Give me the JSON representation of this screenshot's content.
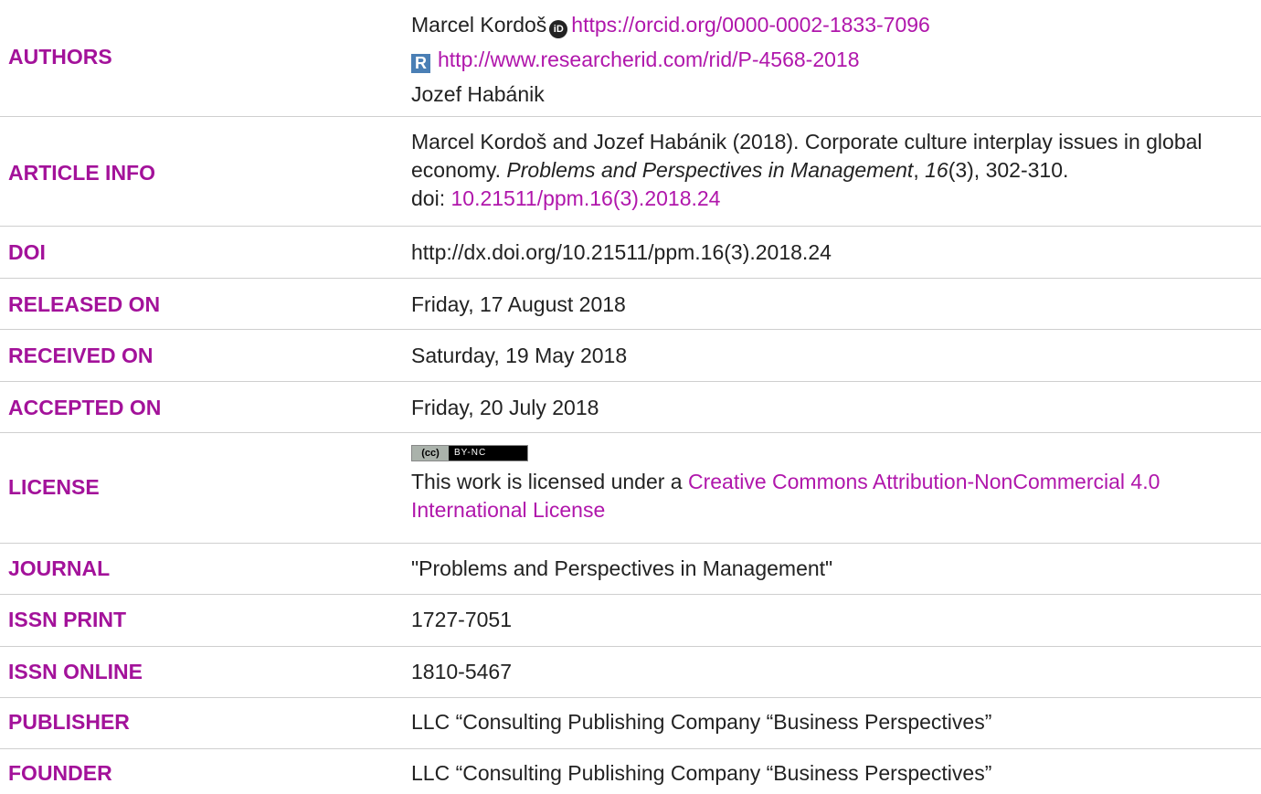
{
  "labels": {
    "authors": "AUTHORS",
    "article_info": "ARTICLE INFO",
    "doi": "DOI",
    "released_on": "RELEASED ON",
    "received_on": "RECEIVED ON",
    "accepted_on": "ACCEPTED ON",
    "license": "LICENSE",
    "journal": "JOURNAL",
    "issn_print": "ISSN PRINT",
    "issn_online": "ISSN ONLINE",
    "publisher": "PUBLISHER",
    "founder": "FOUNDER"
  },
  "authors": {
    "author1": "Marcel Kordoš",
    "orcid_icon_text": "iD",
    "orcid_url": "https://orcid.org/0000-0002-1833-7096",
    "researcherid_icon_text": "R",
    "researcherid_url": "http://www.researcherid.com/rid/P-4568-2018",
    "author2": "Jozef Habánik"
  },
  "article_info": {
    "part1": "Marcel Kordoš and Jozef Habánik (2018). Corporate culture interplay issues in global economy. ",
    "journal_italic": "Problems and Perspectives in Management",
    "part2": ", ",
    "volume_italic": "16",
    "part3": "(3), 302-310.",
    "doi_prefix": "doi: ",
    "doi_link": "10.21511/ppm.16(3).2018.24"
  },
  "doi": "http://dx.doi.org/10.21511/ppm.16(3).2018.24",
  "released_on": "Friday, 17 August 2018",
  "received_on": "Saturday, 19 May 2018",
  "accepted_on": "Friday, 20 July 2018",
  "license": {
    "badge_left": "(cc)",
    "badge_right": "BY-NC",
    "text_prefix": "This work is licensed under a ",
    "link_text": "Creative Commons Attribution-NonCommercial 4.0 International License"
  },
  "journal": "\"Problems and Perspectives in Management\"",
  "issn_print": "1727-7051",
  "issn_online": "1810-5467",
  "publisher": "LLC “Consulting Publishing Company “Business Perspectives”",
  "founder": "LLC “Consulting Publishing Company “Business Perspectives”",
  "colors": {
    "label": "#a3129a",
    "link": "#b016ab",
    "separator": "#cfcfcf"
  }
}
